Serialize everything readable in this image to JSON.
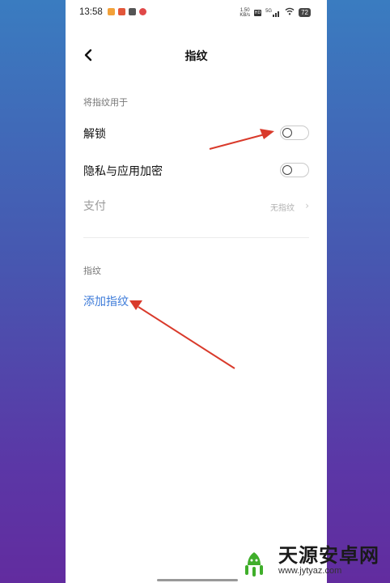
{
  "status_bar": {
    "time": "13:58",
    "speed_top": "1.50",
    "speed_bottom": "KB/s",
    "hd_label": "HD",
    "network": "5G",
    "battery": "72"
  },
  "header": {
    "title": "指纹"
  },
  "usage_section": {
    "title": "将指纹用于",
    "items": [
      {
        "label": "解锁",
        "toggle_on": false
      },
      {
        "label": "隐私与应用加密",
        "toggle_on": false
      },
      {
        "label": "支付",
        "value": "无指纹",
        "disabled": true
      }
    ]
  },
  "fingerprint_section": {
    "title": "指纹",
    "add_link": "添加指纹"
  },
  "watermark": {
    "title": "天源安卓网",
    "url": "www.jytyaz.com"
  },
  "colors": {
    "link": "#3d7bd9",
    "annotation_arrow": "#d93a2b",
    "background_gradient_top": "#3a7cc0",
    "background_gradient_bottom": "#622c9f"
  },
  "icons": [
    "back-arrow-icon",
    "wifi-icon",
    "signal-icon",
    "battery-icon",
    "chevron-right-icon"
  ]
}
